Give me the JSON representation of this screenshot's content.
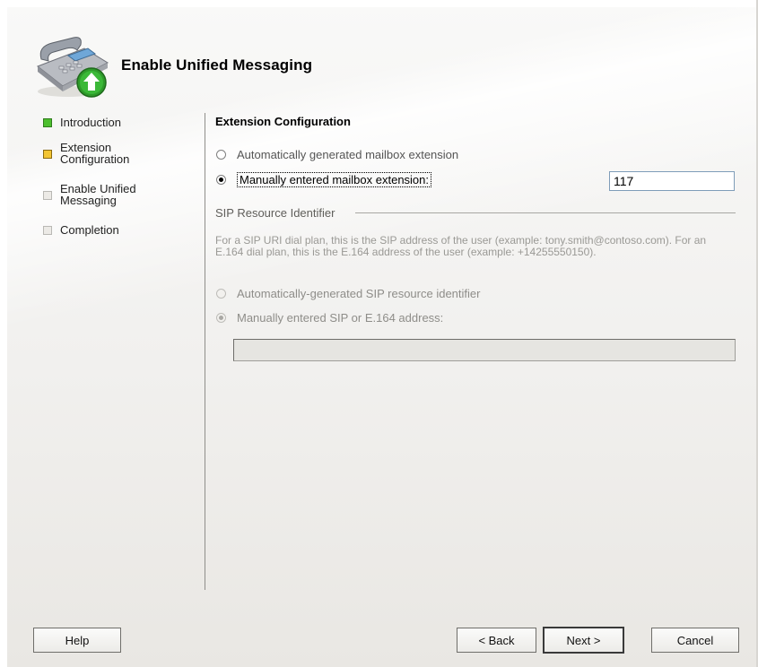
{
  "window": {
    "title": "Enable Unified Messaging",
    "icon": "phone-upgrade-icon"
  },
  "nav": {
    "items": [
      {
        "label": "Introduction",
        "state": "done"
      },
      {
        "label": "Extension Configuration",
        "state": "current"
      },
      {
        "label": "Enable Unified Messaging",
        "state": "pending"
      },
      {
        "label": "Completion",
        "state": "pending"
      }
    ]
  },
  "extension": {
    "section_title": "Extension Configuration",
    "auto_option": "Automatically generated mailbox extension",
    "manual_option": "Manually entered mailbox extension:",
    "selected": "manual",
    "value": "117"
  },
  "sip": {
    "group_label": "SIP Resource Identifier",
    "help_text": "For a SIP URI dial plan, this is the SIP address of the user (example: tony.smith@contoso.com). For an E.164 dial plan, this is the E.164 address of the user (example: +14255550150).",
    "auto_option": "Automatically-generated SIP resource identifier",
    "manual_option": "Manually entered SIP or E.164 address:",
    "selected": "manual",
    "enabled": false,
    "value": ""
  },
  "buttons": {
    "help": "Help",
    "back": "< Back",
    "next": "Next >",
    "cancel": "Cancel"
  }
}
